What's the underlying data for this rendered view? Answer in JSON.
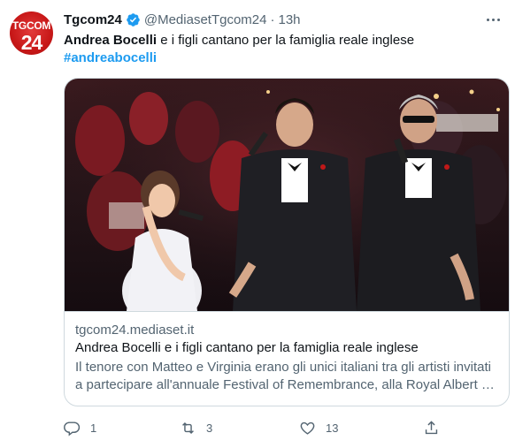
{
  "tweet": {
    "avatar_top": "TGCOM",
    "avatar_num": "24",
    "name": "Tgcom24",
    "handle": "@MediasetTgcom24",
    "separator": "·",
    "time": "13h",
    "text_bold": "Andrea Bocelli",
    "text_rest": " e i figli cantano per la famiglia reale inglese",
    "hashtag": "#andreabocelli"
  },
  "card": {
    "domain": "tgcom24.mediaset.it",
    "title": "Andrea Bocelli e i figli cantano per la famiglia reale inglese",
    "description": "Il tenore con Matteo e Virginia erano gli unici italiani tra gli artisti invitati a partecipare all'annuale Festival of Remembrance, alla Royal Albert …"
  },
  "actions": {
    "reply_count": "1",
    "retweet_count": "3",
    "like_count": "13"
  },
  "colors": {
    "accent": "#1d9bf0",
    "secondary_text": "#536471",
    "border": "#cfd9de"
  },
  "icons": [
    "verified-badge-icon",
    "more-options-icon",
    "reply-icon",
    "retweet-icon",
    "like-icon",
    "share-icon"
  ]
}
